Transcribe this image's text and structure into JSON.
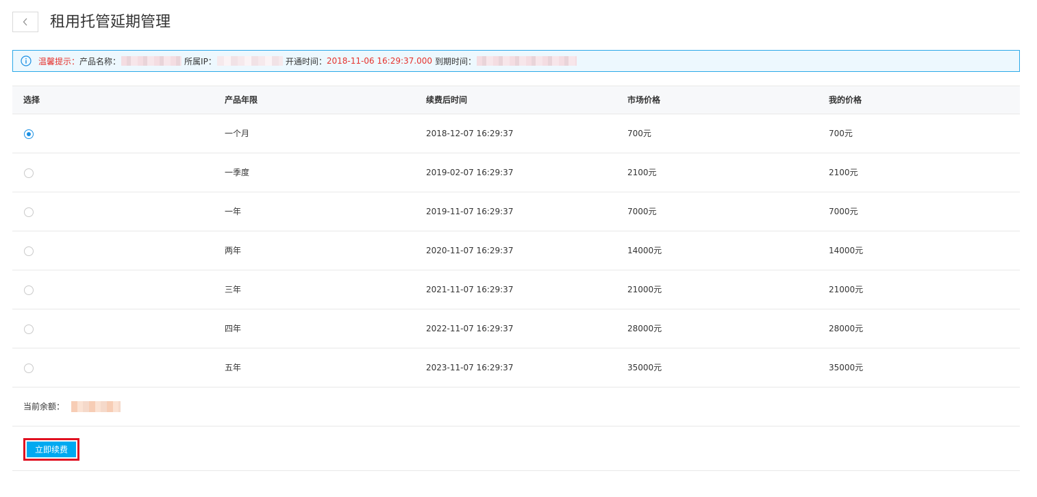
{
  "header": {
    "title": "租用托管延期管理",
    "back_icon": "chevron-left-icon"
  },
  "notice": {
    "icon": "info-icon",
    "prefix": "温馨提示：",
    "product_label": "产品名称：",
    "ip_label": "所属IP：",
    "open_label": "开通时间：",
    "open_time": "2018-11-06 16:29:37.000",
    "expire_label": "到期时间：",
    "colors": {
      "accent": "#e5322d",
      "border": "#2aa8e8",
      "background": "#edf8fe"
    }
  },
  "table": {
    "columns": [
      "选择",
      "产品年限",
      "续费后时间",
      "市场价格",
      "我的价格"
    ],
    "rows": [
      {
        "selected": true,
        "term": "一个月",
        "renew_time": "2018-12-07 16:29:37",
        "market_price": "700元",
        "my_price": "700元"
      },
      {
        "selected": false,
        "term": "一季度",
        "renew_time": "2019-02-07 16:29:37",
        "market_price": "2100元",
        "my_price": "2100元"
      },
      {
        "selected": false,
        "term": "一年",
        "renew_time": "2019-11-07 16:29:37",
        "market_price": "7000元",
        "my_price": "7000元"
      },
      {
        "selected": false,
        "term": "两年",
        "renew_time": "2020-11-07 16:29:37",
        "market_price": "14000元",
        "my_price": "14000元"
      },
      {
        "selected": false,
        "term": "三年",
        "renew_time": "2021-11-07 16:29:37",
        "market_price": "21000元",
        "my_price": "21000元"
      },
      {
        "selected": false,
        "term": "四年",
        "renew_time": "2022-11-07 16:29:37",
        "market_price": "28000元",
        "my_price": "28000元"
      },
      {
        "selected": false,
        "term": "五年",
        "renew_time": "2023-11-07 16:29:37",
        "market_price": "35000元",
        "my_price": "35000元"
      }
    ]
  },
  "balance": {
    "label": "当前余额："
  },
  "actions": {
    "renew_label": "立即续费",
    "colors": {
      "button": "#00a9f0",
      "highlight_border": "#e01020"
    }
  }
}
